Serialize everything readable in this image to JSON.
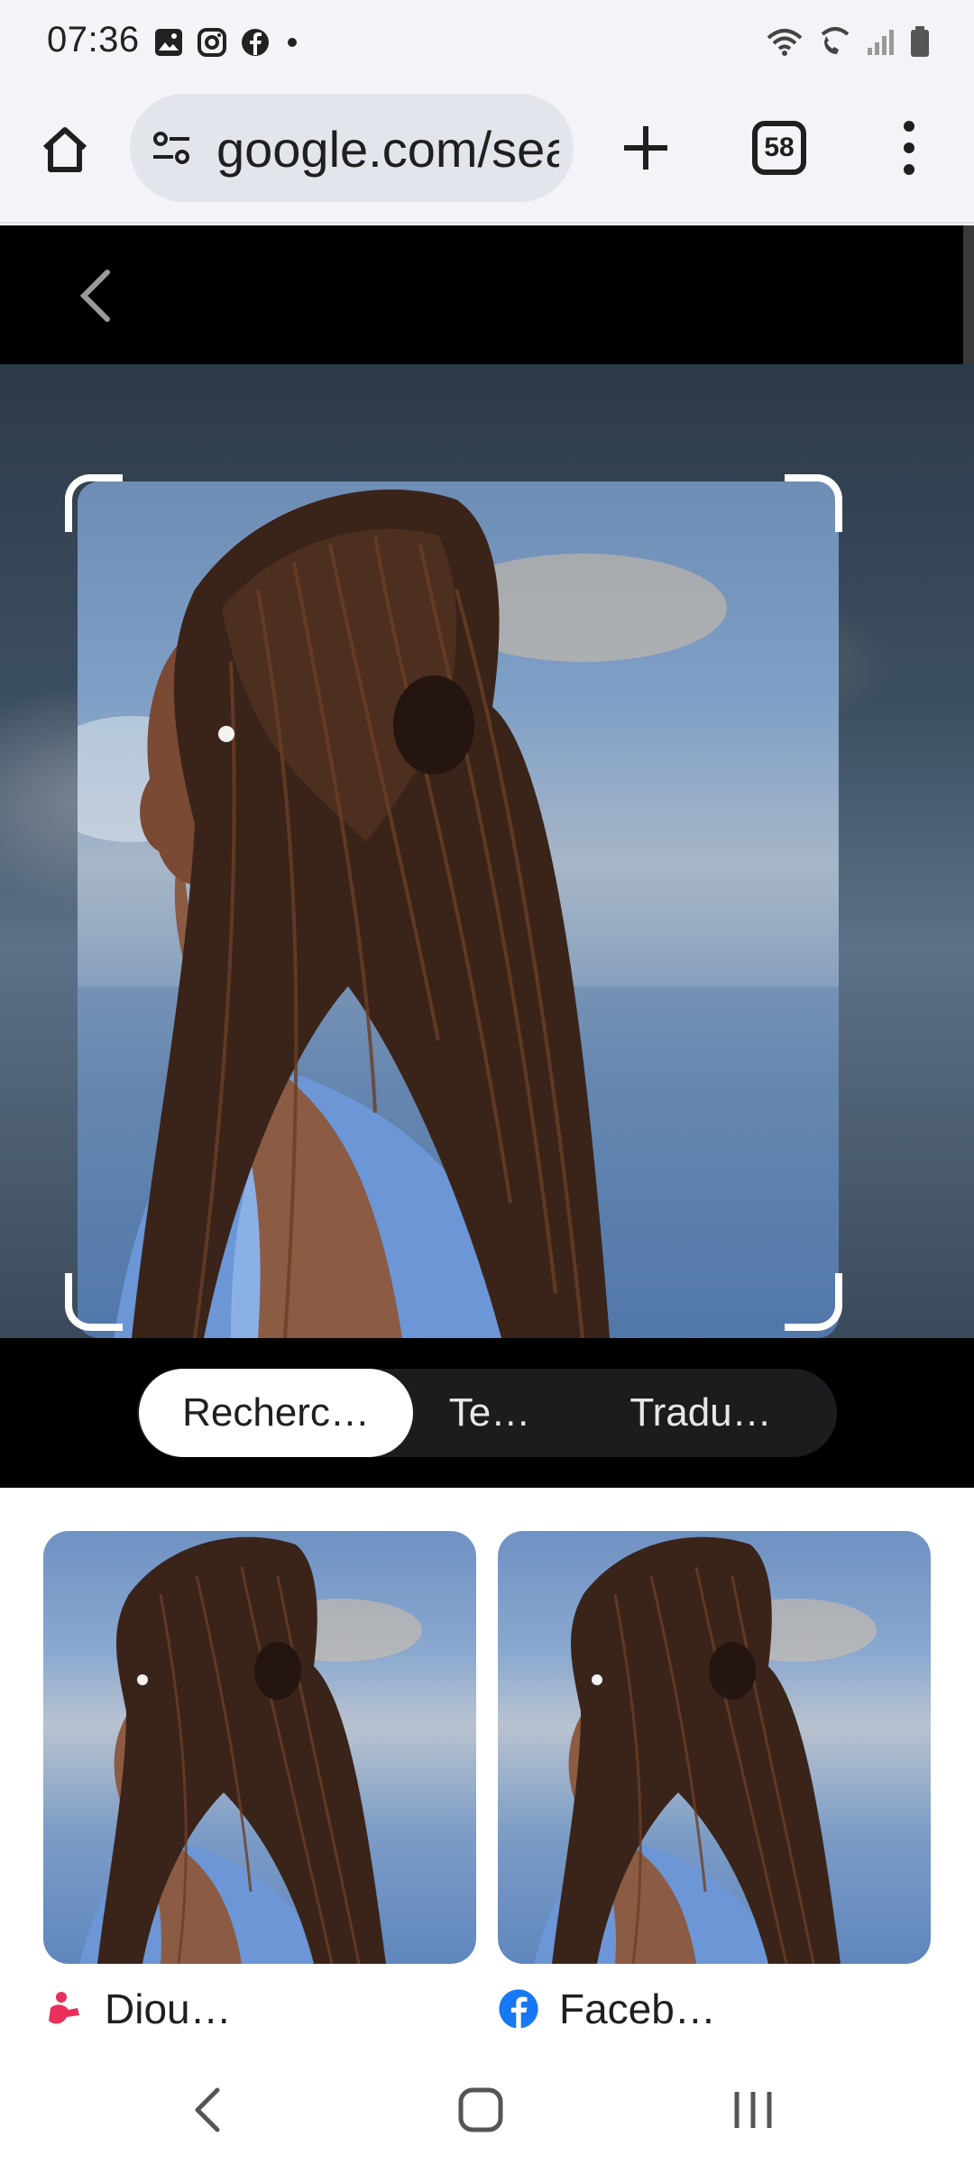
{
  "status_bar": {
    "time": "07:36",
    "notification_icons": [
      "gallery-icon",
      "instagram-icon",
      "facebook-icon",
      "dot-icon"
    ],
    "right_icons": [
      "wifi-icon",
      "wifi-calling-icon",
      "signal-icon",
      "battery-icon"
    ]
  },
  "browser": {
    "url": "google.com/search",
    "tab_count": "58"
  },
  "lens": {
    "modes": [
      "Recherc…",
      "Te…",
      "Tradu…"
    ],
    "active_mode_index": 0
  },
  "results": [
    {
      "source_label": "Diou…",
      "source_icon": "site-favicon-icon",
      "source_color": "#e8305a"
    },
    {
      "source_label": "Faceb…",
      "source_icon": "facebook-icon",
      "source_color": "#1877f2"
    }
  ],
  "nav_bar": {
    "buttons": [
      "back-icon",
      "home-icon",
      "recents-icon"
    ]
  },
  "colors": {
    "toolbar_bg": "#f4f4f8",
    "omnibox_bg": "#e3e5ec",
    "lens_bg": "#000000",
    "active_tab_bg": "#ffffff"
  }
}
